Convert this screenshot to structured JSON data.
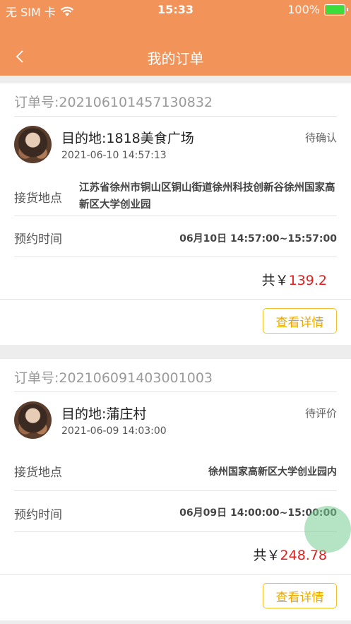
{
  "status_bar": {
    "carrier": "无 SIM 卡",
    "time": "15:33",
    "battery": "100%",
    "battery_level": 1.0
  },
  "nav": {
    "title": "我的订单",
    "back_icon": "chevron-left-icon"
  },
  "orders": [
    {
      "order_no": "订单号:202106101457130832",
      "destination": "目的地:1818美食广场",
      "time": "2021-06-10 14:57:13",
      "status": "待确认",
      "pickup_label": "接货地点",
      "pickup_value": "江苏省徐州市铜山区铜山街道徐州科技创新谷徐州国家高新区大学创业园",
      "appointment_label": "预约时间",
      "appointment_value": "06月10日 14:57:00~15:57:00",
      "total_prefix": "共￥",
      "total_amount": "139.2",
      "detail_button": "查看详情"
    },
    {
      "order_no": "订单号:202106091403001003",
      "destination": "目的地:蒲庄村",
      "time": "2021-06-09 14:03:00",
      "status": "待评价",
      "pickup_label": "接货地点",
      "pickup_value": "徐州国家高新区大学创业园内",
      "appointment_label": "预约时间",
      "appointment_value": "06月09日 14:00:00~15:00:00",
      "total_prefix": "共￥",
      "total_amount": "248.78",
      "detail_button": "查看详情"
    }
  ],
  "colors": {
    "header": "#f2935a",
    "price": "#e02020",
    "button_border": "#f3c125",
    "battery": "#3ddc3d"
  }
}
